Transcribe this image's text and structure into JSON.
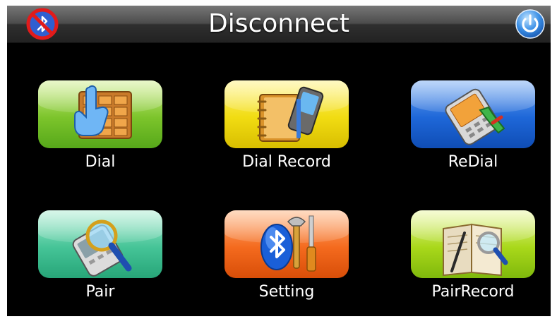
{
  "header": {
    "title": "Disconnect",
    "left_icon": "bluetooth-disabled-icon",
    "right_icon": "power-icon"
  },
  "menu": [
    {
      "label": "Dial",
      "icon": "dial-keypad-icon",
      "color": "#7cc42b"
    },
    {
      "label": "Dial Record",
      "icon": "dial-record-icon",
      "color": "#f1dc12"
    },
    {
      "label": "ReDial",
      "icon": "redial-phone-icon",
      "color": "#1e67d8"
    },
    {
      "label": "Pair",
      "icon": "pair-search-icon",
      "color": "#45c497"
    },
    {
      "label": "Setting",
      "icon": "setting-tools-icon",
      "color": "#f46a1e"
    },
    {
      "label": "PairRecord",
      "icon": "pair-record-icon",
      "color": "#a9d81a"
    }
  ]
}
